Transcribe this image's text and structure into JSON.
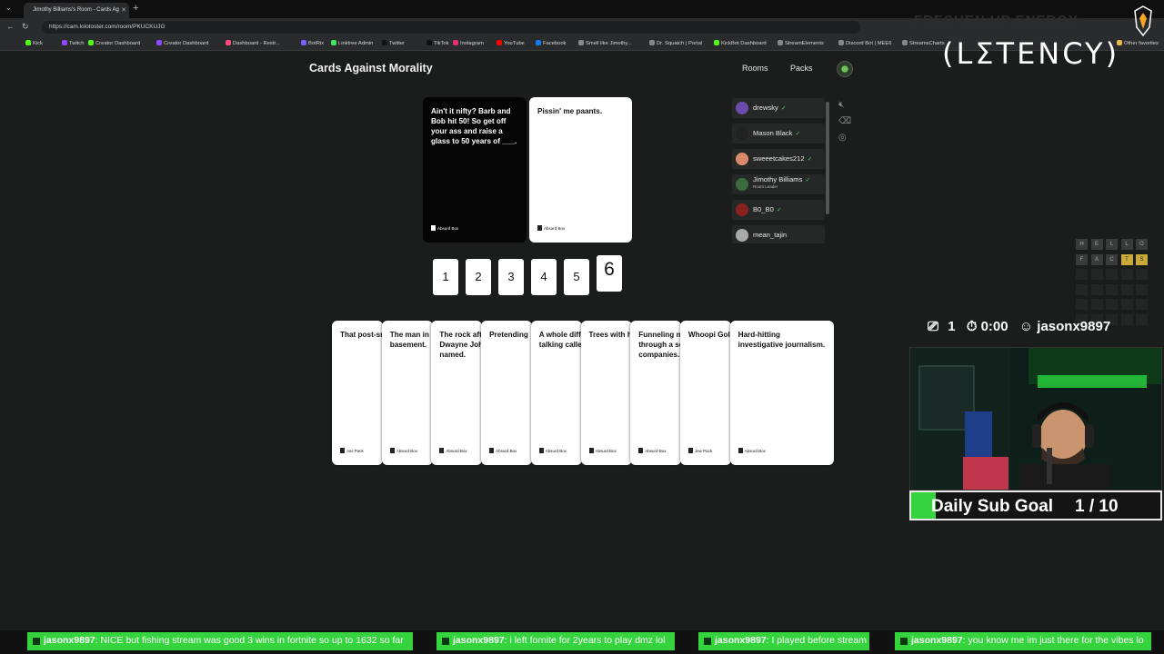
{
  "browser": {
    "tab_title": "Jimothy Billiams's Room - Cards Ag",
    "url": "https://cam.lolotoster.com/room/PKUCKUJG",
    "bookmarks": [
      {
        "label": "Kick",
        "color": "#53fc18"
      },
      {
        "label": "Twitch",
        "color": "#9146ff"
      },
      {
        "label": "Creator Dashboard",
        "color": "#53fc18"
      },
      {
        "label": "Creator Dashboard",
        "color": "#9146ff"
      },
      {
        "label": "Dashboard - Restr...",
        "color": "#ff4d7a"
      },
      {
        "label": "BotRix",
        "color": "#7a5cff"
      },
      {
        "label": "Linktree Admin",
        "color": "#43e660"
      },
      {
        "label": "Twitter",
        "color": "#111111"
      },
      {
        "label": "TikTok",
        "color": "#111111"
      },
      {
        "label": "Instagram",
        "color": "#e1306c"
      },
      {
        "label": "YouTube",
        "color": "#ff0000"
      },
      {
        "label": "Facebook",
        "color": "#1877f2"
      },
      {
        "label": "Smell like Jimothy...",
        "color": "#888888"
      },
      {
        "label": "Dr. Squatch | Portal",
        "color": "#888888"
      },
      {
        "label": "KickBot Dashboard",
        "color": "#53fc18"
      },
      {
        "label": "StreamElements",
        "color": "#888888"
      },
      {
        "label": "Discord Bot | MEE6",
        "color": "#888888"
      },
      {
        "label": "StreamsCharts",
        "color": "#888888"
      },
      {
        "label": "Other favorites",
        "color": "#e8b94a"
      }
    ]
  },
  "app": {
    "title": "Cards Against Morality",
    "nav_rooms": "Rooms",
    "nav_packs": "Packs"
  },
  "prompt_card": {
    "text": "Ain't it nifty? Barb and Bob hit 50! So get off your ass and raise a glass to 50 years of ___.",
    "brand": "Absurd Box"
  },
  "played_card": {
    "text": "Pissin' me paants.",
    "brand": "Absurd Box"
  },
  "number_buttons": [
    "1",
    "2",
    "3",
    "4",
    "5",
    "6"
  ],
  "hand": [
    {
      "text": "That post-sr",
      "brand": "Ass Pack"
    },
    {
      "text": "The man in t basement.",
      "brand": "Absurd Box"
    },
    {
      "text": "The rock aft Dwayne Joh named.",
      "brand": "Absurd Box"
    },
    {
      "text": "Pretending",
      "brand": "Absurd Box"
    },
    {
      "text": "A whole diff talking calle",
      "brand": "Absurd Box"
    },
    {
      "text": "Trees with h",
      "brand": "Absurd Box"
    },
    {
      "text": "Funneling m through a se companies.",
      "brand": "Absurd Box"
    },
    {
      "text": "Whoopi Gol",
      "brand": "Jew Pack"
    },
    {
      "text": "Hard-hitting investigative journalism.",
      "brand": "Absurd Box"
    }
  ],
  "players": [
    {
      "name": "drewsky",
      "ready": true,
      "avatar_color": "#6a4caa"
    },
    {
      "name": "Mason Black",
      "ready": true,
      "avatar_color": "#222222"
    },
    {
      "name": "sweeetcakes212",
      "ready": true,
      "avatar_color": "#d98a6a"
    },
    {
      "name": "Jimothy Billiams",
      "subtitle": "Room Leader",
      "ready": true,
      "avatar_color": "#3b6b3a"
    },
    {
      "name": "B0_B0",
      "ready": true,
      "avatar_color": "#8a2222"
    },
    {
      "name": "mean_tajin",
      "ready": false,
      "avatar_color": "#aaaaaa"
    }
  ],
  "wordle": {
    "rows": [
      [
        "H",
        "E",
        "L",
        "L",
        "O"
      ],
      [
        "F",
        "A",
        "C",
        "T",
        "S"
      ]
    ],
    "highlight_colors": {
      "T": "#c9a93a",
      "S": "#c9a93a"
    }
  },
  "overlay": {
    "sponsor_text": "FRESHEN UP ENERGY",
    "latency_logo": "(LΣTENCY)"
  },
  "stream_stats": {
    "viewers": "1",
    "timer": "0:00",
    "username": "jasonx9897"
  },
  "sub_goal": {
    "label": "Daily Sub Goal",
    "count": "1 / 10",
    "progress": 0.1,
    "fill_color": "#35d43e"
  },
  "chat": [
    {
      "user": "jasonx9897",
      "message": "NICE but fishing stream was good 3 wins in fortnite so up to 1632 so far"
    },
    {
      "user": "jasonx9897",
      "message": "i left fornite for 2years to play dmz lol"
    },
    {
      "user": "jasonx9897",
      "message": "I played before stream"
    },
    {
      "user": "jasonx9897",
      "message": "you know me im just there for the vibes lo"
    }
  ]
}
